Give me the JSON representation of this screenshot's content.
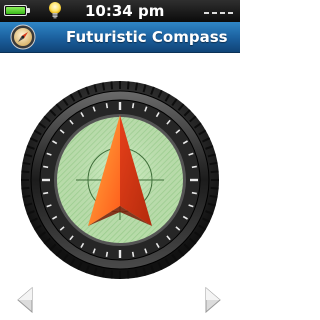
{
  "status_bar": {
    "time": "10:34 pm",
    "battery_icon": "battery-icon",
    "battery_level": 1.0,
    "battery_color": "#4fd62c",
    "light_icon": "lightbulb-icon",
    "signal_icon": "signal-dashes-icon"
  },
  "title_bar": {
    "app_icon": "compass-icon",
    "title": "Futuristic Compass",
    "background_color": "#1b5f9d"
  },
  "compass": {
    "dial_icon": "compass-dial",
    "needle_icon": "compass-needle-arrow",
    "needle_color": "#ff6a1f",
    "face_color": "#c8f0b8",
    "bezel_color": "#2b2b2b"
  },
  "navigation": {
    "prev_icon": "arrow-left-icon",
    "next_icon": "arrow-right-icon"
  }
}
